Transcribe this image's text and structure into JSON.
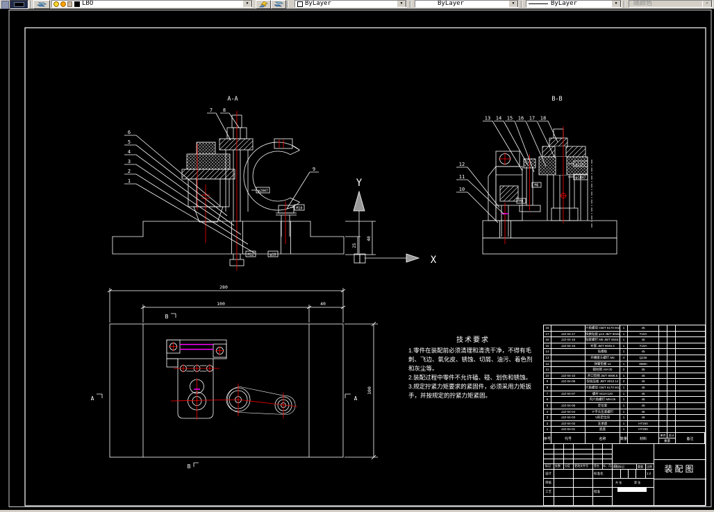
{
  "colors": {
    "line": "#ffffff",
    "centerline": "#ff0000",
    "accent": "#ff00ff",
    "toolbar_bg": "#d4d0c8",
    "canvas_bg": "#000000"
  },
  "toolbar": {
    "layer": "LBO",
    "color": "ByLayer",
    "linetype": "ByLayer",
    "lineweight": "ByLayer",
    "plotstyle": "随颜色"
  },
  "drawing": {
    "section_aa": {
      "label": "A-A",
      "balloons": {
        "b1": "1",
        "b2": "2",
        "b3": "3",
        "b4": "4",
        "b5": "5",
        "b6": "6",
        "b7": "7",
        "b8": "8",
        "b9": "9"
      },
      "dims": {
        "d1": "M12",
        "d2": "φ10",
        "d3": "φ20H7",
        "d4": "M10",
        "d5": "40",
        "d6": "25"
      }
    },
    "section_bb": {
      "label": "B-B",
      "balloons": {
        "b10": "10",
        "b11": "11",
        "b12": "12",
        "b13": "13",
        "b14": "14",
        "b15": "15",
        "b16": "16",
        "b17": "17",
        "b18": "18"
      },
      "dims": {
        "d1": "φ12H7",
        "d2": "φ18H7",
        "d3": "M6",
        "d4": "M8"
      }
    },
    "plan": {
      "dims": {
        "width": "280",
        "left": "100",
        "right": "40",
        "height": "100"
      },
      "labels": {
        "a_left": "A",
        "a_right": "A",
        "b_top": "B",
        "b_bottom": "B"
      }
    },
    "ucs": {
      "x": "X",
      "y": "Y"
    }
  },
  "tech": {
    "title": "技术要求",
    "lines": [
      "1.零件在装配前必须清理和清洗干净，不得有毛",
      "刺、飞边、氧化皮、锈蚀、切屑、油污、着色剂",
      "和灰尘等。",
      "2.装配过程中零件不允许磕、碰、划伤和锈蚀。",
      "3.规定拧紧力矩要求的紧固件，必须采用力矩扳",
      "手，并按规定的拧紧力矩紧固。"
    ]
  },
  "bom": {
    "headers": {
      "no": "序号",
      "code": "代号",
      "name": "名称",
      "qty": "数量",
      "material": "材料",
      "unit": "单件",
      "total": "总计",
      "weight": "重量",
      "note": "备注"
    },
    "rows": [
      [
        "18",
        "",
        "六角螺母 GB/T 6170 M16",
        "1",
        "45"
      ],
      [
        "17",
        "JJZ-04-17",
        "快换钻套 φ12 JB/T 8045.3",
        "1",
        "T10A"
      ],
      [
        "16",
        "JJZ-04-16",
        "钻套螺钉 M8 JB/T 8045.5",
        "1",
        "45"
      ],
      [
        "15",
        "JJZ-04-15",
        "衬套 JB/T 8045.4",
        "1",
        "T10A"
      ],
      [
        "14",
        "",
        "钻模板",
        "1",
        "45"
      ],
      [
        "13",
        "",
        "开槽盘头螺钉 M6",
        "4",
        "Q235"
      ],
      [
        "12",
        "",
        "弹簧垫圈 12",
        "1",
        "65Mn"
      ],
      [
        "11",
        "",
        "圆柱销 A8×30",
        "2",
        "35"
      ],
      [
        "10",
        "JJZ-04-10",
        "开口垫圈 JB/T 8008.5",
        "1",
        "45"
      ],
      [
        "9",
        "JJZ-04-09",
        "铰链压板 JB/T 8010.14",
        "2",
        "45"
      ],
      [
        "8",
        "",
        "六角螺母 GB/T 6170 M12",
        "1",
        "45"
      ],
      [
        "7",
        "JJZ-04-07",
        "螺杆 M12×120",
        "1",
        "45"
      ],
      [
        "6",
        "",
        "内六角螺钉 M8×25",
        "1",
        "45"
      ],
      [
        "5",
        "JJZ-04-05",
        "定位套",
        "1",
        "45"
      ],
      [
        "4",
        "JJZ-04-04",
        "十字头压紧螺钉",
        "1",
        "45"
      ],
      [
        "3",
        "JJZ-04-03",
        "V形定位块",
        "1",
        "45"
      ],
      [
        "2",
        "JJZ-04-02",
        "支承座",
        "1",
        "HT200"
      ],
      [
        "1",
        "JJZ-04-01",
        "底座",
        "1",
        "HT200"
      ]
    ]
  },
  "title_block": {
    "mark": "标记",
    "count": "处数",
    "zone": "分区",
    "doc": "更改文件号",
    "sign": "签名",
    "date": "年、月、日",
    "design": "设计",
    "standard": "标准化",
    "check": "审核",
    "process": "工艺",
    "approve": "批准",
    "stage": "阶段标记",
    "weight": "重量",
    "scale": "比例",
    "scale_val": "1:2",
    "sheets": "共 张",
    "sheet": "第 张",
    "title": "装配图"
  }
}
